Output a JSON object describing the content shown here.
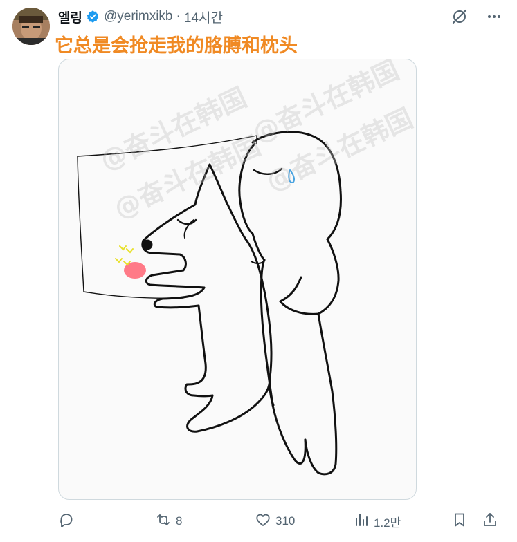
{
  "author": {
    "display_name": "엘링",
    "handle": "@yerimxikb",
    "separator": "·",
    "time": "14시간"
  },
  "tweet": {
    "text": "它总是会抢走我的胳膊和枕头"
  },
  "media": {
    "watermark": "@奋斗在韩国"
  },
  "actions": {
    "reply_count": "",
    "retweet_count": "8",
    "like_count": "310",
    "view_count": "1.2만"
  },
  "colors": {
    "accent_text": "#f08a24",
    "verified": "#1d9bf0",
    "secondary": "#536471"
  },
  "icons": [
    "verified-badge-icon",
    "grok-icon",
    "more-icon",
    "reply-icon",
    "retweet-icon",
    "like-icon",
    "views-icon",
    "bookmark-icon",
    "share-icon"
  ]
}
